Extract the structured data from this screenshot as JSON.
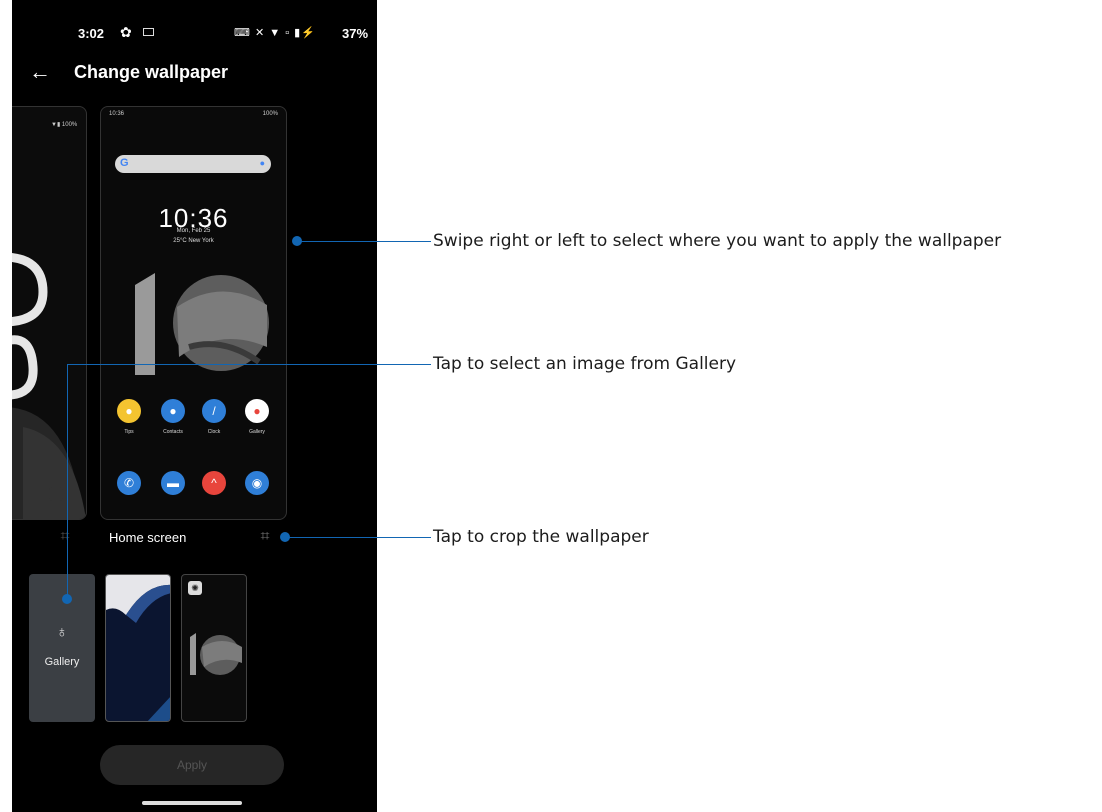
{
  "status_bar": {
    "time": "3:02",
    "battery": "37%",
    "icons": [
      "settings-gear-icon",
      "image-icon",
      "keyboard-icon",
      "notifications-off-icon",
      "wifi-icon",
      "no-sim-icon",
      "battery-charging-icon"
    ]
  },
  "header": {
    "title": "Change wallpaper"
  },
  "lock_preview": {
    "partial_time": "0\n6"
  },
  "home_preview": {
    "clock": "10:36",
    "date": "Mon, Feb 25",
    "weather": "25°C  New York",
    "small_time": "10:36",
    "small_battery": "100%",
    "apps_row1": [
      {
        "label": "Tips",
        "color": "#f4c430"
      },
      {
        "label": "Contacts",
        "color": "#2f7fd8"
      },
      {
        "label": "Clock",
        "color": "#2f7fd8"
      },
      {
        "label": "Gallery",
        "color": "#ffffff"
      }
    ],
    "dock_colors": [
      "#2f7fd8",
      "#2f7fd8",
      "#e8453c",
      "#2f7fd8"
    ]
  },
  "preview_label": "Home screen",
  "thumbnails": {
    "gallery_label": "Gallery"
  },
  "apply_button": "Apply",
  "callouts": {
    "swipe": "Swipe right or left to select where you want to apply the wallpaper",
    "gallery": "Tap to select an image from Gallery",
    "crop": "Tap to crop the wallpaper"
  },
  "colors": {
    "accent": "#1266b3",
    "background": "#000000"
  }
}
